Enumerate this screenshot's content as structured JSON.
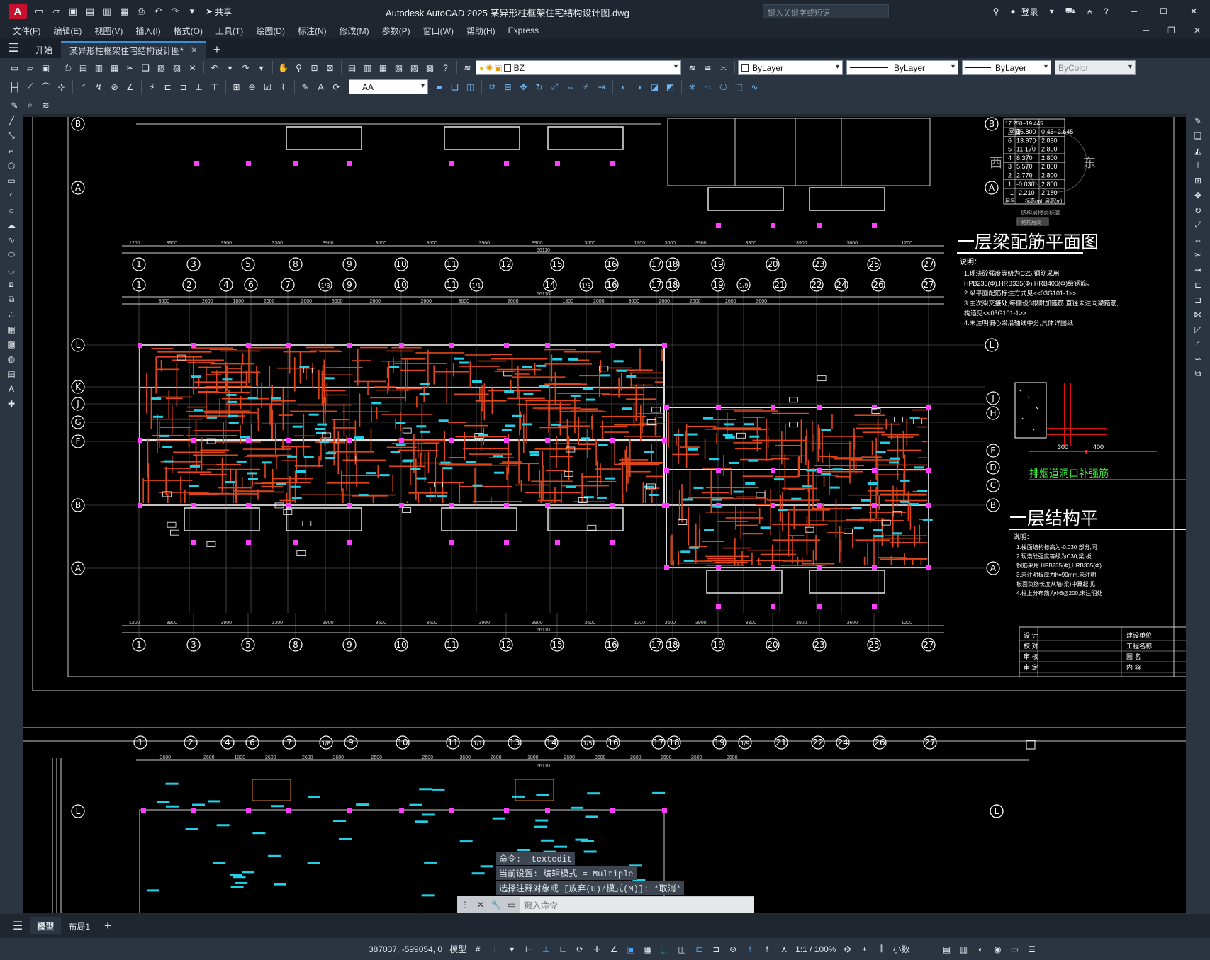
{
  "titlebar": {
    "app_logo": "A",
    "share_label": "共享",
    "title": "Autodesk AutoCAD 2025    某异形柱框架住宅结构设计图.dwg",
    "search_placeholder": "键入关键字或短语",
    "login_label": "登录"
  },
  "menubar": {
    "items": [
      "文件(F)",
      "编辑(E)",
      "视图(V)",
      "插入(I)",
      "格式(O)",
      "工具(T)",
      "绘图(D)",
      "标注(N)",
      "修改(M)",
      "参数(P)",
      "窗口(W)",
      "帮助(H)",
      "Express"
    ]
  },
  "tabs": {
    "start_label": "开始",
    "doc_label": "某异形柱框架住宅结构设计图*"
  },
  "toolbar": {
    "layer_value": "BZ",
    "color_value": "ByLayer",
    "linetype_value": "ByLayer",
    "lineweight_value": "ByLayer",
    "plotstyle_value": "ByColor",
    "textstyle_value": "AA"
  },
  "drawing": {
    "title_upper": "一层梁配筋平面图",
    "title_lower": "一层结构平",
    "caption_exhaust": "排烟道洞口补强筋",
    "notes_label": "说明：",
    "notes": [
      "1.现浇砼强度等级为C25,钢筋采用",
      "HPB235(Φ),HRB335(Φ),HRB400(Φ)级钢筋。",
      "2.梁平面配筋标注方式见<<03G101-1>>",
      "3.主次梁交接处,每侧设3根附加箍筋,直径未注同梁箍筋,",
      "构造见<<03G101-1>>",
      "4.未注明偏心梁沿轴线中分,具体详图纸"
    ],
    "notes2": [
      "1.楼面结构标高为-0.030 部分,同",
      "2.现浇砼强度等级为C30,梁,板",
      "钢筋采用 HPB235(Φ),HRB335(Φ)",
      "3.未注明板厚为h=90mm,未注明",
      "板面负筋长度从墙(梁)中算起,见",
      "4.柱上分布筋为Φ6@200,未注明处"
    ],
    "compass": {
      "west": "西",
      "east": "东"
    },
    "total_dim": "56110",
    "top_dims": [
      "1200",
      "3900",
      "3900",
      "3300",
      "3900",
      "3600",
      "3600",
      "3900",
      "3900",
      "3600",
      "1200",
      "3600",
      "3900",
      "3300",
      "3900",
      "3600",
      "1200"
    ],
    "mid_dims": [
      "3600",
      "2600",
      "1800",
      "2600",
      "2600",
      "3600",
      "2600",
      "2600",
      "3600",
      "2600",
      "1800",
      "2600",
      "3600",
      "2600",
      "2600",
      "2600",
      "3600"
    ],
    "axes_a": [
      "1",
      "3",
      "5",
      "8",
      "9",
      "10",
      "11",
      "12",
      "15",
      "16",
      "17",
      "18",
      "19",
      "20",
      "23",
      "25",
      "27"
    ],
    "axes_b": [
      "1",
      "2",
      "4",
      "6",
      "7",
      "1/8",
      "9",
      "10",
      "11",
      "1/1",
      "14",
      "1/5",
      "16",
      "17",
      "18",
      "19",
      "1/9",
      "21",
      "22",
      "24",
      "26",
      "27"
    ],
    "axes_c": [
      "1",
      "2",
      "4",
      "6",
      "7",
      "1/8",
      "9",
      "10",
      "11",
      "1/1",
      "13",
      "14",
      "1/5",
      "16",
      "17",
      "18",
      "19",
      "1/9",
      "21",
      "22",
      "24",
      "26",
      "27"
    ],
    "rows_left": [
      "B",
      "A",
      "L",
      "K",
      "J",
      "G",
      "F",
      "B",
      "A",
      "L"
    ],
    "rows_right": [
      "B",
      "A",
      "L",
      "J",
      "H",
      "E",
      "D",
      "C",
      "B",
      "A",
      "L"
    ],
    "table_head": "17.250~19.445",
    "table_rows": [
      [
        "屋面",
        "16.800",
        "0.45~2.645"
      ],
      [
        "6",
        "13.970",
        "2.830"
      ],
      [
        "5",
        "11.170",
        "2.800"
      ],
      [
        "4",
        "8.370",
        "2.800"
      ],
      [
        "3",
        "5.570",
        "2.800"
      ],
      [
        "2",
        "2.770",
        "2.800"
      ],
      [
        "1",
        "-0.030",
        "2.800"
      ],
      [
        "-1",
        "-2.210",
        "2.180"
      ]
    ],
    "table_foot": [
      "层号",
      "标高(m)",
      "层高(m)"
    ],
    "table_caption": "结构层楼面标高",
    "table_caption2": "结构层高",
    "titleblock": [
      "设 计",
      "校 对",
      "审 核",
      "审 定"
    ],
    "titleblock_r": [
      "建设单位",
      "工程名称",
      "图 名",
      "内 容"
    ]
  },
  "command": {
    "line1": "命令: _textedit",
    "line2": "当前设置: 编辑模式 = Multiple",
    "line3": "选择注释对象或 [放弃(U)/模式(M)]: *取消*",
    "input_placeholder": "键入命令"
  },
  "layouts": {
    "model_label": "模型",
    "layout1_label": "布局1"
  },
  "status": {
    "coords": "387037, -599054, 0",
    "model_label": "模型",
    "scale_label": "1:1 / 100%",
    "units_label": "小数"
  }
}
